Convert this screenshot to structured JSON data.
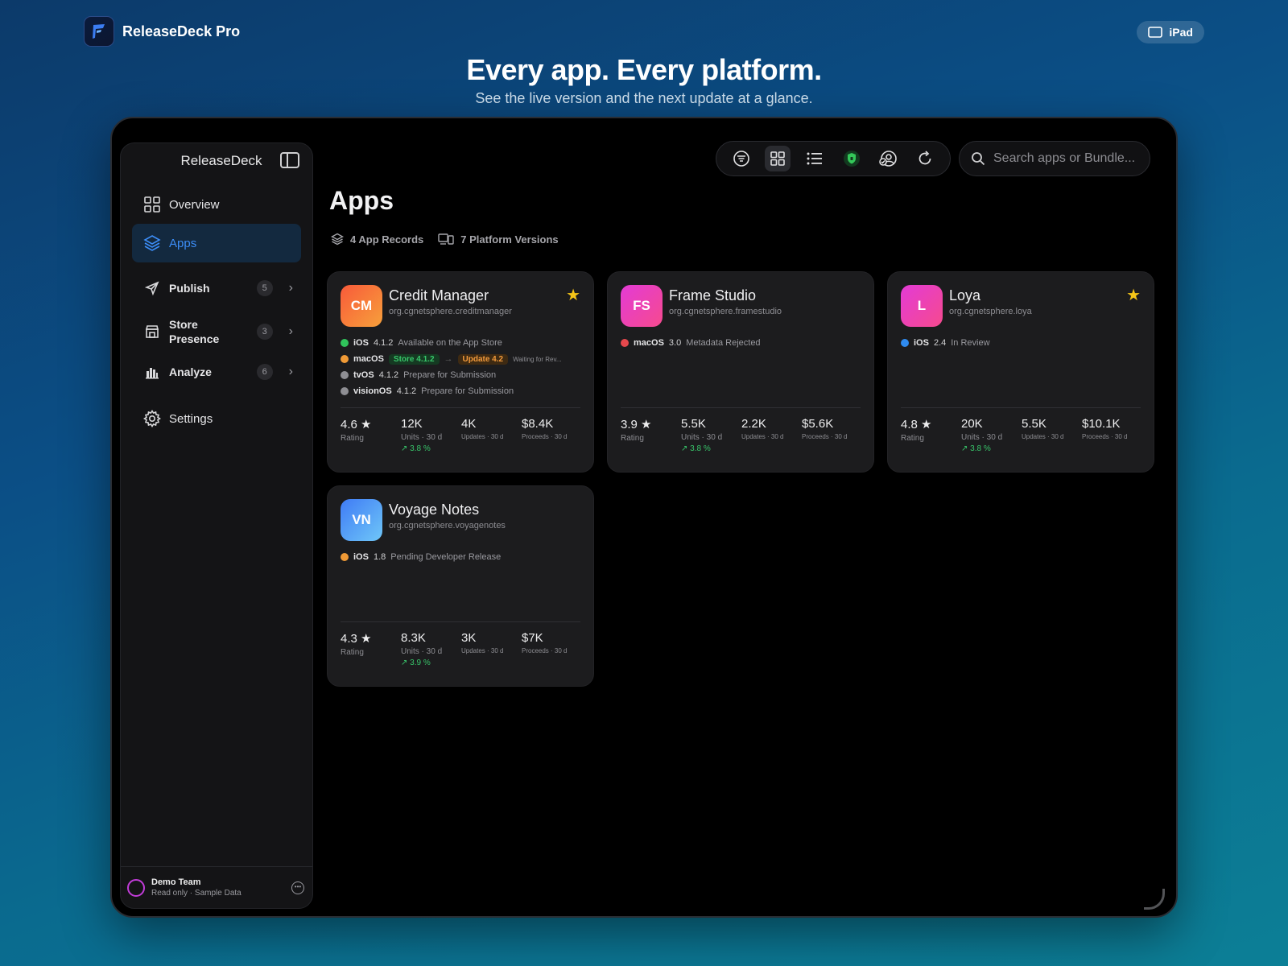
{
  "promo": {
    "app_name": "ReleaseDeck Pro",
    "device_label": "iPad",
    "title": "Every app. Every platform.",
    "subtitle": "See the live version and the next update at a glance."
  },
  "sidebar": {
    "title": "ReleaseDeck",
    "items": [
      {
        "label": "Overview",
        "icon": "grid-icon"
      },
      {
        "label": "Apps",
        "icon": "layers-icon",
        "active": true
      },
      {
        "label": "Publish",
        "icon": "send-icon",
        "badge": "5"
      },
      {
        "label": "Store\nPresence",
        "icon": "store-icon",
        "badge": "3"
      },
      {
        "label": "Analyze",
        "icon": "chart-icon",
        "badge": "6"
      },
      {
        "label": "Settings",
        "icon": "gear-icon"
      }
    ],
    "footer": {
      "team": "Demo Team",
      "mode": "Read only · Sample Data"
    }
  },
  "toolbar": {
    "icons": [
      "filter-icon",
      "grid-view-icon",
      "list-view-icon",
      "shield-icon",
      "account-icon",
      "refresh-icon"
    ],
    "search_placeholder": "Search apps or Bundle..."
  },
  "main": {
    "title": "Apps",
    "app_records": "4 App Records",
    "platform_versions": "7 Platform Versions"
  },
  "apps": [
    {
      "initials": "CM",
      "name": "Credit Manager",
      "bundle": "org.cgnetsphere.creditmanager",
      "favorite": true,
      "platforms": [
        {
          "name": "iOS",
          "version": "4.1.2",
          "status": "Available on the App Store",
          "color": "#30c35b"
        },
        {
          "name": "macOS",
          "store": "Store 4.1.2",
          "update": "Update 4.2",
          "status": "Waiting for Rev...",
          "color": "#f09a36"
        },
        {
          "name": "tvOS",
          "version": "4.1.2",
          "status": "Prepare for Submission",
          "color": "#8e8e93"
        },
        {
          "name": "visionOS",
          "version": "4.1.2",
          "status": "Prepare for Submission",
          "color": "#8e8e93"
        }
      ],
      "stats": {
        "rating": "4.6",
        "rating_label": "Rating",
        "units": "12K",
        "units_label": "Units · 30 d",
        "trend": "3.8 %",
        "updates": "4K",
        "updates_label": "Updates · 30 d",
        "proceeds": "$8.4K",
        "proceeds_label": "Proceeds · 30 d"
      }
    },
    {
      "initials": "FS",
      "name": "Frame Studio",
      "bundle": "org.cgnetsphere.framestudio",
      "favorite": false,
      "platforms": [
        {
          "name": "macOS",
          "version": "3.0",
          "status": "Metadata Rejected",
          "color": "#e5484d"
        }
      ],
      "stats": {
        "rating": "3.9",
        "rating_label": "Rating",
        "units": "5.5K",
        "units_label": "Units · 30 d",
        "trend": "3.8 %",
        "updates": "2.2K",
        "updates_label": "Updates · 30 d",
        "proceeds": "$5.6K",
        "proceeds_label": "Proceeds · 30 d"
      }
    },
    {
      "initials": "L",
      "name": "Loya",
      "bundle": "org.cgnetsphere.loya",
      "favorite": true,
      "platforms": [
        {
          "name": "iOS",
          "version": "2.4",
          "status": "In Review",
          "color": "#2f8bf0"
        }
      ],
      "stats": {
        "rating": "4.8",
        "rating_label": "Rating",
        "units": "20K",
        "units_label": "Units · 30 d",
        "trend": "3.8 %",
        "updates": "5.5K",
        "updates_label": "Updates · 30 d",
        "proceeds": "$10.1K",
        "proceeds_label": "Proceeds · 30 d"
      }
    },
    {
      "initials": "VN",
      "name": "Voyage Notes",
      "bundle": "org.cgnetsphere.voyagenotes",
      "favorite": false,
      "platforms": [
        {
          "name": "iOS",
          "version": "1.8",
          "status": "Pending Developer Release",
          "color": "#f09a36"
        }
      ],
      "stats": {
        "rating": "4.3",
        "rating_label": "Rating",
        "units": "8.3K",
        "units_label": "Units · 30 d",
        "trend": "3.9 %",
        "updates": "3K",
        "updates_label": "Updates · 30 d",
        "proceeds": "$7K",
        "proceeds_label": "Proceeds · 30 d"
      }
    }
  ],
  "colors": {
    "accent": "#3c8df7",
    "cm_gradient": [
      "#f85a3a",
      "#f7a03b"
    ],
    "fs_gradient": [
      "#e33bd6",
      "#f64a8e"
    ],
    "l_gradient": [
      "#e33bd6",
      "#f64a8e"
    ],
    "vn_gradient": [
      "#3f7bf5",
      "#6fc7f8"
    ]
  }
}
